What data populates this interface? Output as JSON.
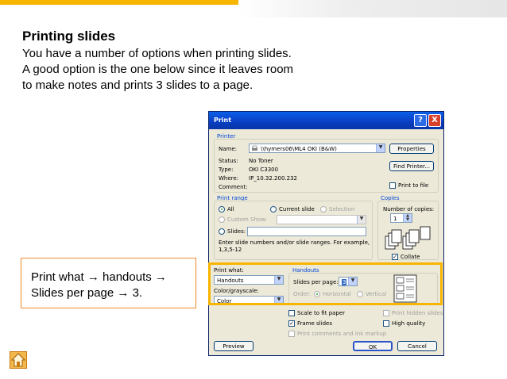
{
  "slide": {
    "title": "Printing slides",
    "body_lines": [
      "You have a number of options when printing slides.",
      "A good option is the one below since it leaves room",
      "to make notes and prints 3 slides to a page."
    ],
    "callout_lines": [
      "Print what → handouts →",
      "Slides per page → 3."
    ]
  },
  "dialog": {
    "title": "Print",
    "help": "?",
    "close": "X",
    "printer": {
      "group": "Printer",
      "name_label": "Name:",
      "name_value": "\\\\hymers06\\ML4 OKI (B&W)",
      "status_label": "Status:",
      "status_value": "No Toner",
      "type_label": "Type:",
      "type_value": "OKI C3300",
      "where_label": "Where:",
      "where_value": "IP_10.32.200.232",
      "comment_label": "Comment:",
      "properties": "Properties",
      "find_printer": "Find Printer...",
      "print_to_file": "Print to file"
    },
    "range": {
      "group": "Print range",
      "all": "All",
      "current_slide": "Current slide",
      "selection": "Selection",
      "custom_show": "Custom Show:",
      "slides": "Slides:",
      "hint_line1": "Enter slide numbers and/or slide ranges. For example,",
      "hint_line2": "1,3,5-12"
    },
    "copies": {
      "group": "Copies",
      "number_label": "Number of copies:",
      "number_value": "1",
      "collate": "Collate"
    },
    "print_what": {
      "label": "Print what:",
      "value": "Handouts",
      "color_label": "Color/grayscale:",
      "color_value": "Color"
    },
    "handouts": {
      "group": "Handouts",
      "slides_per_page_label": "Slides per page:",
      "slides_per_page_value": "3",
      "order_label": "Order:",
      "horizontal": "Horizontal",
      "vertical": "Vertical"
    },
    "options": {
      "scale_to_fit": "Scale to fit paper",
      "frame_slides": "Frame slides",
      "print_comments": "Print comments and ink markup",
      "print_hidden": "Print hidden slides",
      "high_quality": "High quality"
    },
    "buttons": {
      "preview": "Preview",
      "ok": "OK",
      "cancel": "Cancel"
    }
  },
  "colors": {
    "accent": "#f7b500",
    "callout_border": "#f08a2c",
    "title_bar": "#0a3ec2"
  }
}
